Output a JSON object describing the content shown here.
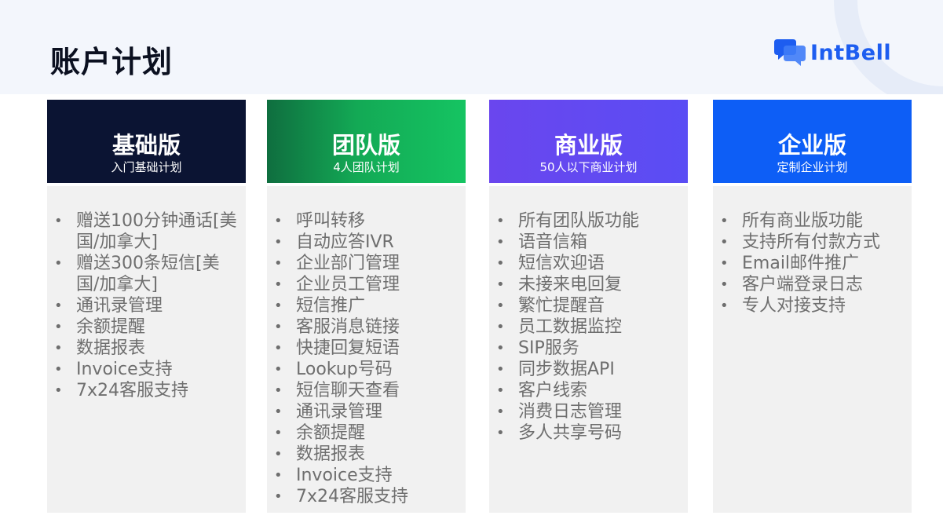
{
  "page": {
    "title": "账户计划"
  },
  "brand": {
    "name": "IntBell",
    "color": "#1d5df0"
  },
  "plans": [
    {
      "name": "基础版",
      "subtitle": "入门基础计划",
      "features": [
        {
          "text": "赠送100分钟通话[美国/加拿大]",
          "tone": "dark"
        },
        {
          "text": "赠送300条短信[美国/加拿大]",
          "tone": "purple"
        },
        {
          "text": "通讯录管理",
          "tone": "gray"
        },
        {
          "text": "余额提醒",
          "tone": "gray"
        },
        {
          "text": "数据报表",
          "tone": "gray"
        },
        {
          "text": "Invoice支持",
          "tone": "gray"
        },
        {
          "text": "7x24客服支持",
          "tone": "gray"
        }
      ]
    },
    {
      "name": "团队版",
      "subtitle": "4人团队计划",
      "features": [
        {
          "text": "呼叫转移",
          "tone": "gray"
        },
        {
          "text": "自动应答IVR",
          "tone": "gray"
        },
        {
          "text": "企业部门管理",
          "tone": "gray"
        },
        {
          "text": "企业员工管理",
          "tone": "gray"
        },
        {
          "text": "短信推广",
          "tone": "gray"
        },
        {
          "text": "客服消息链接",
          "tone": "gray"
        },
        {
          "text": "快捷回复短语",
          "tone": "gray"
        },
        {
          "text": "Lookup号码",
          "tone": "gray"
        },
        {
          "text": "短信聊天查看",
          "tone": "gray"
        },
        {
          "text": "通讯录管理",
          "tone": "gray"
        },
        {
          "text": "余额提醒",
          "tone": "gray"
        },
        {
          "text": "数据报表",
          "tone": "gray"
        },
        {
          "text": "Invoice支持",
          "tone": "gray"
        },
        {
          "text": "7x24客服支持",
          "tone": "gray"
        }
      ]
    },
    {
      "name": "商业版",
      "subtitle": "50人以下商业计划",
      "features": [
        {
          "text": "所有团队版功能",
          "tone": "blue"
        },
        {
          "text": "语音信箱",
          "tone": "gray"
        },
        {
          "text": "短信欢迎语",
          "tone": "gray"
        },
        {
          "text": "未接来电回复",
          "tone": "gray"
        },
        {
          "text": "繁忙提醒音",
          "tone": "gray"
        },
        {
          "text": "员工数据监控",
          "tone": "gray"
        },
        {
          "text": "SIP服务",
          "tone": "gray"
        },
        {
          "text": "同步数据API",
          "tone": "gray"
        },
        {
          "text": "客户线索",
          "tone": "gray"
        },
        {
          "text": "消费日志管理",
          "tone": "gray"
        },
        {
          "text": "多人共享号码",
          "tone": "green"
        }
      ]
    },
    {
      "name": "企业版",
      "subtitle": "定制企业计划",
      "features": [
        {
          "text": "所有商业版功能",
          "tone": "blue"
        },
        {
          "text": "支持所有付款方式",
          "tone": "gray"
        },
        {
          "text": "Email邮件推广",
          "tone": "gray"
        },
        {
          "text": "客户端登录日志",
          "tone": "gray"
        },
        {
          "text": "专人对接支持",
          "tone": "gray"
        }
      ]
    }
  ],
  "colors": {
    "basic_header": "#0b1433",
    "team_header_gradient": [
      "#0f6e3f",
      "#15c462"
    ],
    "business_header_gradient": [
      "#6a46ee",
      "#5a4df4"
    ],
    "enterprise_header": "#0d5ef6",
    "dark_text": "#0b1433",
    "purple_text": "#6a4cf0",
    "blue_text": "#1b6fe0",
    "green_text": "#13b04e",
    "gray_text": "#6e6e6e"
  }
}
